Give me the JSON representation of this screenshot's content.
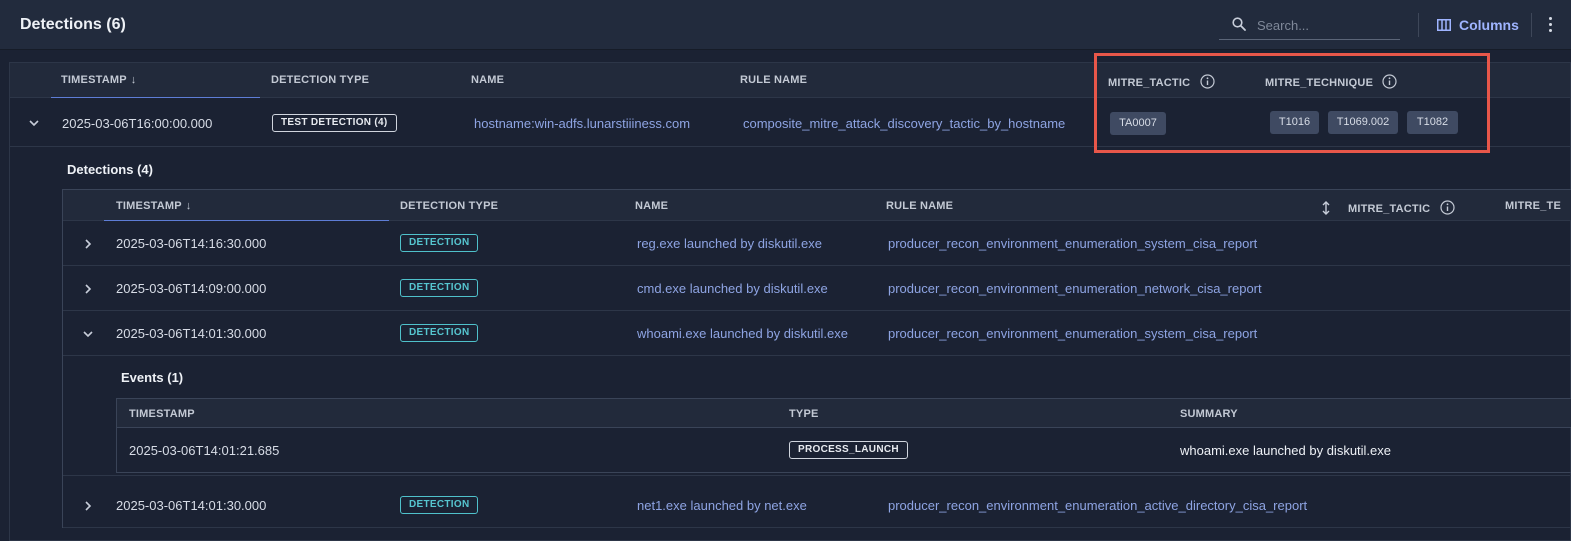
{
  "header": {
    "title": "Detections (6)",
    "search_placeholder": "Search...",
    "columns_label": "Columns"
  },
  "outer_table": {
    "columns": {
      "timestamp": "TIMESTAMP",
      "sort_arrow": "↓",
      "detection_type": "DETECTION TYPE",
      "name": "NAME",
      "rule_name": "RULE NAME",
      "mitre_tactic": "MITRE_TACTIC",
      "mitre_technique": "MITRE_TECHNIQUE"
    },
    "row": {
      "timestamp": "2025-03-06T16:00:00.000",
      "detection_type": "TEST DETECTION (4)",
      "name": "hostname:win-adfs.lunarstiiiness.com",
      "rule_name": "composite_mitre_attack_discovery_tactic_by_hostname",
      "tactics": [
        "TA0007"
      ],
      "techniques": [
        "T1016",
        "T1069.002",
        "T1082"
      ]
    }
  },
  "inner_table": {
    "title": "Detections (4)",
    "columns": {
      "timestamp": "TIMESTAMP",
      "sort_arrow": "↓",
      "detection_type": "DETECTION TYPE",
      "name": "NAME",
      "rule_name": "RULE NAME",
      "mitre_tactic": "MITRE_TACTIC",
      "mitre_technique": "MITRE_TE"
    },
    "rows": [
      {
        "timestamp": "2025-03-06T14:16:30.000",
        "detection_type": "DETECTION",
        "name": "reg.exe launched by diskutil.exe",
        "rule_name": "producer_recon_environment_enumeration_system_cisa_report"
      },
      {
        "timestamp": "2025-03-06T14:09:00.000",
        "detection_type": "DETECTION",
        "name": "cmd.exe launched by diskutil.exe",
        "rule_name": "producer_recon_environment_enumeration_network_cisa_report"
      },
      {
        "timestamp": "2025-03-06T14:01:30.000",
        "detection_type": "DETECTION",
        "name": "whoami.exe launched by diskutil.exe",
        "rule_name": "producer_recon_environment_enumeration_system_cisa_report"
      },
      {
        "timestamp": "2025-03-06T14:01:30.000",
        "detection_type": "DETECTION",
        "name": "net1.exe launched by net.exe",
        "rule_name": "producer_recon_environment_enumeration_active_directory_cisa_report"
      }
    ]
  },
  "events_table": {
    "title": "Events (1)",
    "columns": {
      "timestamp": "TIMESTAMP",
      "type": "TYPE",
      "summary": "SUMMARY"
    },
    "rows": [
      {
        "timestamp": "2025-03-06T14:01:21.685",
        "type": "PROCESS_LAUNCH",
        "summary": "whoami.exe launched by diskutil.exe"
      }
    ]
  },
  "colors": {
    "background": "#1b2233",
    "link": "#8ea4e3",
    "accent": "#9fb4ff",
    "detection_badge": "#56c6d0",
    "highlight": "#e8574a"
  }
}
